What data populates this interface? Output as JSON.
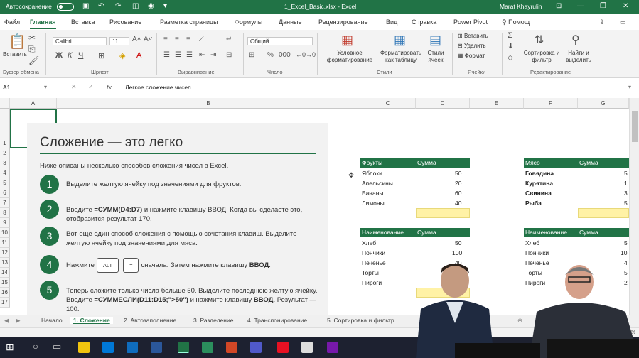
{
  "titlebar": {
    "autosave": "Автосохранение",
    "filename": "1_Excel_Basic.xlsx  -  Excel",
    "user": "Marat Khayrulin"
  },
  "menu": [
    "Файл",
    "Главная",
    "Вставка",
    "Рисование",
    "Разметка страницы",
    "Формулы",
    "Данные",
    "Рецензирование",
    "Вид",
    "Справка",
    "Power Pivot",
    "Помощ"
  ],
  "ribbon": {
    "paste": "Вставить",
    "font_name": "Calibri",
    "font_size": "11",
    "number_format": "Общий",
    "cond_format": "Условное форматирование",
    "format_table": "Форматировать как таблицу",
    "cell_styles": "Стили ячеек",
    "insert": "Вставить",
    "delete": "Удалить",
    "format": "Формат",
    "sort": "Сортировка и фильтр",
    "find": "Найти и выделить",
    "groups": [
      "Буфер обмена",
      "Шрифт",
      "Выравнивание",
      "Число",
      "Стили",
      "Ячейки",
      "Редактирование"
    ]
  },
  "formula": {
    "name_box": "A1",
    "fx": "fx",
    "value": "Легкое сложение чисел"
  },
  "columns": [
    "A",
    "B",
    "C",
    "D",
    "E",
    "F",
    "G"
  ],
  "rows": [
    "1",
    "2",
    "3",
    "4",
    "5",
    "6",
    "7",
    "8",
    "9",
    "10",
    "11",
    "12",
    "13",
    "14",
    "15",
    "16",
    "17"
  ],
  "panel": {
    "title": "Сложение — это легко",
    "intro": "Ниже описаны несколько способов сложения чисел в Excel.",
    "steps": [
      {
        "n": "1",
        "text": "Выделите желтую ячейку под значениями для фруктов."
      },
      {
        "n": "2",
        "pre": "Введите ",
        "bold": "=СУММ(D4:D7)",
        "post": " и нажмите клавишу ВВОД. Когда вы сделаете это, отобразится результат 170."
      },
      {
        "n": "3",
        "text": "Вот еще один способ сложения с помощью сочетания клавиш. Выделите желтую ячейку под значениями для мяса."
      },
      {
        "n": "4",
        "pre": "Нажмите",
        "k1": "ALT",
        "k2": "=",
        "post": "сначала. Затем нажмите клавишу ",
        "bold": "ВВОД",
        "tail": "."
      },
      {
        "n": "5",
        "pre": "Теперь сложите только числа больше 50. Выделите последнюю желтую ячейку. Введите ",
        "bold": "=СУММЕСЛИ(D11:D15;\">50\")",
        "post": " и нажмите клавишу ",
        "bold2": "ВВОД",
        "tail": ". Результат — 100."
      }
    ]
  },
  "fruits": {
    "h1": "Фрукты",
    "h2": "Сумма",
    "rows": [
      [
        "Яблоки",
        "50"
      ],
      [
        "Апельсины",
        "20"
      ],
      [
        "Бананы",
        "60"
      ],
      [
        "Лимоны",
        "40"
      ]
    ]
  },
  "meat": {
    "h1": "Мясо",
    "h2": "Сумма",
    "rows": [
      [
        "Говядина",
        "5"
      ],
      [
        "Курятина",
        "1"
      ],
      [
        "Свинина",
        "3"
      ],
      [
        "Рыба",
        "5"
      ]
    ]
  },
  "items1": {
    "h1": "Наименование",
    "h2": "Сумма",
    "rows": [
      [
        "Хлеб",
        "50"
      ],
      [
        "Пончики",
        "100"
      ],
      [
        "Печенье",
        "40"
      ],
      [
        "Торты",
        ""
      ],
      [
        "Пироги",
        ""
      ]
    ]
  },
  "items2": {
    "h1": "Наименование",
    "h2": "Сумма",
    "rows": [
      [
        "Хлеб",
        "5"
      ],
      [
        "Пончики",
        "10"
      ],
      [
        "Печенье",
        "4"
      ],
      [
        "Торты",
        "5"
      ],
      [
        "Пироги",
        "2"
      ]
    ]
  },
  "tabs": [
    "Начало",
    "1. Сложение",
    "2. Автозаполнение",
    "3. Разделение",
    "4. Транспонирование",
    "5. Сортировка и фильтр"
  ],
  "status": {
    "zoom": "100 %"
  },
  "accent": "#217346"
}
